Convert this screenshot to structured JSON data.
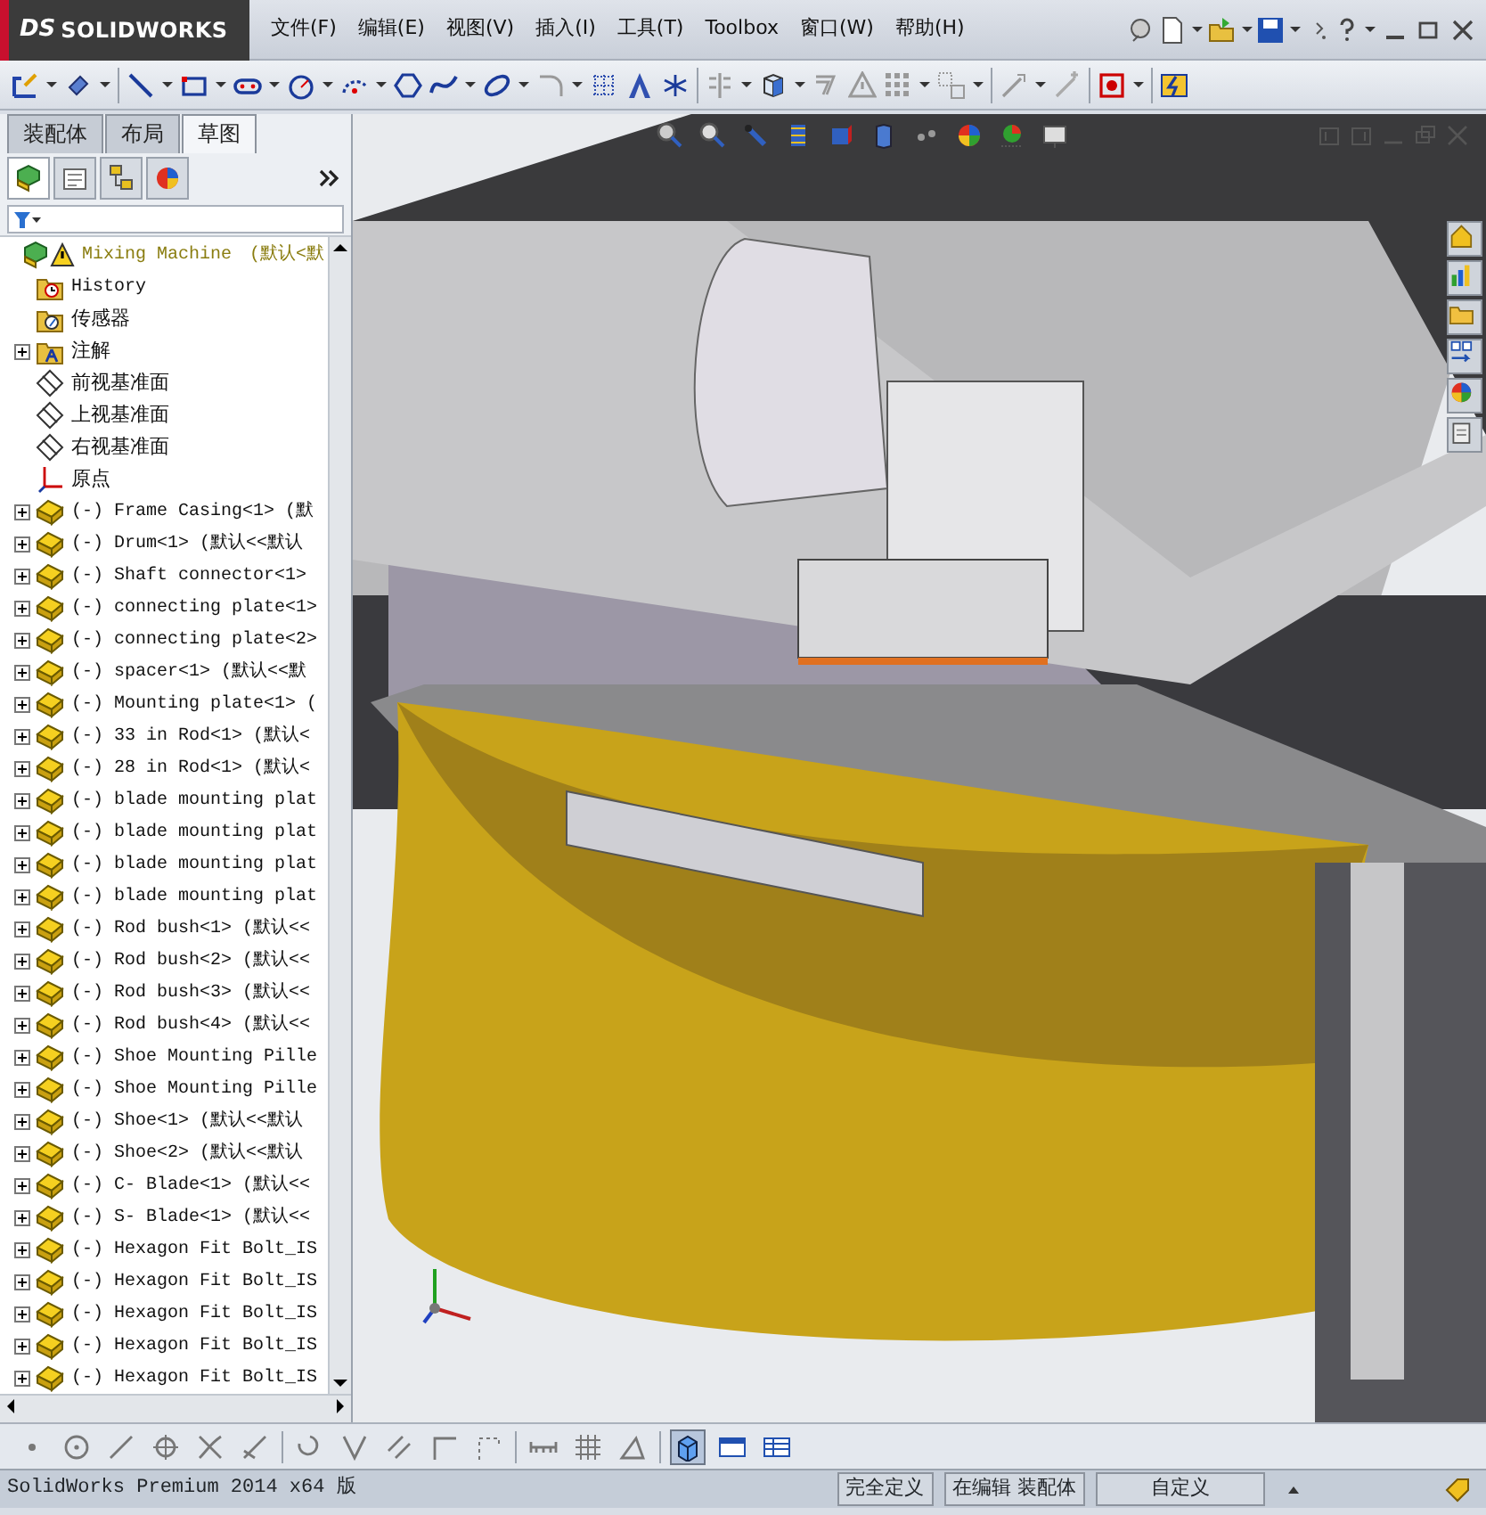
{
  "app": {
    "logo_mark": "DS",
    "logo_text": "SOLIDWORKS"
  },
  "menu": [
    "文件(F)",
    "编辑(E)",
    "视图(V)",
    "插入(I)",
    "工具(T)",
    "Toolbox",
    "窗口(W)",
    "帮助(H)"
  ],
  "panel_tabs": [
    {
      "label": "装配体",
      "selected": false
    },
    {
      "label": "布局",
      "selected": false
    },
    {
      "label": "草图",
      "selected": true
    }
  ],
  "manager_tabs": [
    {
      "kind": "feature",
      "selected": true
    },
    {
      "kind": "property",
      "selected": false
    },
    {
      "kind": "config",
      "selected": false
    },
    {
      "kind": "display",
      "selected": false
    }
  ],
  "tree": {
    "root": {
      "name": "Mixing Machine",
      "config": "(默认<默",
      "warning": true,
      "expanded": true
    },
    "items": [
      {
        "kind": "history",
        "label": "History",
        "expandable": false
      },
      {
        "kind": "sensor",
        "label": "传感器",
        "expandable": false
      },
      {
        "kind": "annotation",
        "label": "注解",
        "expandable": true
      },
      {
        "kind": "plane",
        "label": "前视基准面",
        "expandable": false
      },
      {
        "kind": "plane",
        "label": "上视基准面",
        "expandable": false
      },
      {
        "kind": "plane",
        "label": "右视基准面",
        "expandable": false
      },
      {
        "kind": "origin",
        "label": "原点",
        "expandable": false
      },
      {
        "kind": "part",
        "label": "(-) Frame Casing<1> (默",
        "expandable": true
      },
      {
        "kind": "part",
        "label": "(-) Drum<1> (默认<<默认",
        "expandable": true
      },
      {
        "kind": "part",
        "label": "(-) Shaft connector<1>",
        "expandable": true
      },
      {
        "kind": "part",
        "label": "(-) connecting plate<1>",
        "expandable": true
      },
      {
        "kind": "part",
        "label": "(-) connecting plate<2>",
        "expandable": true
      },
      {
        "kind": "part",
        "label": "(-) spacer<1> (默认<<默",
        "expandable": true
      },
      {
        "kind": "part",
        "label": "(-) Mounting plate<1> (",
        "expandable": true
      },
      {
        "kind": "part",
        "label": "(-) 33 in Rod<1> (默认<",
        "expandable": true
      },
      {
        "kind": "part",
        "label": "(-) 28 in Rod<1> (默认<",
        "expandable": true
      },
      {
        "kind": "part",
        "label": "(-) blade mounting plat",
        "expandable": true
      },
      {
        "kind": "part",
        "label": "(-) blade mounting plat",
        "expandable": true
      },
      {
        "kind": "part",
        "label": "(-) blade mounting plat",
        "expandable": true
      },
      {
        "kind": "part",
        "label": "(-) blade mounting plat",
        "expandable": true
      },
      {
        "kind": "part",
        "label": "(-) Rod bush<1> (默认<<",
        "expandable": true
      },
      {
        "kind": "part",
        "label": "(-) Rod bush<2> (默认<<",
        "expandable": true
      },
      {
        "kind": "part",
        "label": "(-) Rod bush<3> (默认<<",
        "expandable": true
      },
      {
        "kind": "part",
        "label": "(-) Rod bush<4> (默认<<",
        "expandable": true
      },
      {
        "kind": "part",
        "label": "(-) Shoe Mounting Pille",
        "expandable": true
      },
      {
        "kind": "part",
        "label": "(-) Shoe Mounting Pille",
        "expandable": true
      },
      {
        "kind": "part",
        "label": "(-) Shoe<1> (默认<<默认",
        "expandable": true
      },
      {
        "kind": "part",
        "label": "(-) Shoe<2> (默认<<默认",
        "expandable": true
      },
      {
        "kind": "part",
        "label": "(-) C- Blade<1> (默认<<",
        "expandable": true
      },
      {
        "kind": "part",
        "label": "(-) S- Blade<1> (默认<<",
        "expandable": true
      },
      {
        "kind": "part",
        "label": "(-) Hexagon Fit Bolt_IS",
        "expandable": true
      },
      {
        "kind": "part",
        "label": "(-) Hexagon Fit Bolt_IS",
        "expandable": true
      },
      {
        "kind": "part",
        "label": "(-) Hexagon Fit Bolt_IS",
        "expandable": true
      },
      {
        "kind": "part",
        "label": "(-) Hexagon Fit Bolt_IS",
        "expandable": true
      },
      {
        "kind": "part",
        "label": "(-) Hexagon Fit Bolt_IS",
        "expandable": true
      }
    ]
  },
  "sketch_toolbar": [
    {
      "selected": false
    },
    {
      "selected": false
    },
    {
      "selected": false
    },
    {
      "selected": false
    },
    {
      "selected": false
    },
    {
      "selected": false
    },
    {
      "selected": false
    },
    {
      "selected": false
    },
    {
      "selected": false
    },
    {
      "selected": false
    },
    {
      "selected": false
    },
    {
      "selected": false
    },
    {
      "selected": false
    },
    {
      "selected": false
    },
    {
      "selected": true
    },
    {
      "selected": false
    },
    {
      "selected": false
    }
  ],
  "status_bar": {
    "product": "SolidWorks Premium 2014 x64 版",
    "state": "完全定义",
    "mode": "在编辑 装配体",
    "units": "自定义"
  }
}
